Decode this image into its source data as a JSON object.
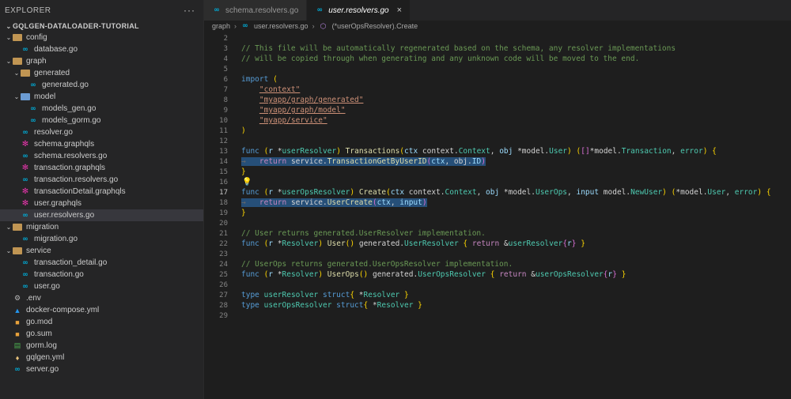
{
  "explorer": {
    "title": "EXPLORER",
    "more": "···",
    "project": "GQLGEN-DATALOADER-TUTORIAL",
    "tree": [
      {
        "label": "config",
        "kind": "folder",
        "indent": 0,
        "open": true
      },
      {
        "label": "database.go",
        "kind": "go",
        "indent": 1
      },
      {
        "label": "graph",
        "kind": "folder",
        "indent": 0,
        "open": true
      },
      {
        "label": "generated",
        "kind": "folder",
        "indent": 1,
        "open": true
      },
      {
        "label": "generated.go",
        "kind": "go",
        "indent": 2
      },
      {
        "label": "model",
        "kind": "folder-blue",
        "indent": 1,
        "open": true
      },
      {
        "label": "models_gen.go",
        "kind": "go",
        "indent": 2
      },
      {
        "label": "models_gorm.go",
        "kind": "go",
        "indent": 2
      },
      {
        "label": "resolver.go",
        "kind": "go",
        "indent": 1
      },
      {
        "label": "schema.graphqls",
        "kind": "gql",
        "indent": 1
      },
      {
        "label": "schema.resolvers.go",
        "kind": "go",
        "indent": 1
      },
      {
        "label": "transaction.graphqls",
        "kind": "gql",
        "indent": 1
      },
      {
        "label": "transaction.resolvers.go",
        "kind": "go",
        "indent": 1
      },
      {
        "label": "transactionDetail.graphqls",
        "kind": "gql",
        "indent": 1
      },
      {
        "label": "user.graphqls",
        "kind": "gql",
        "indent": 1
      },
      {
        "label": "user.resolvers.go",
        "kind": "go",
        "indent": 1,
        "selected": true
      },
      {
        "label": "migration",
        "kind": "folder",
        "indent": 0,
        "open": true
      },
      {
        "label": "migration.go",
        "kind": "go",
        "indent": 1
      },
      {
        "label": "service",
        "kind": "folder",
        "indent": 0,
        "open": true
      },
      {
        "label": "transaction_detail.go",
        "kind": "go",
        "indent": 1
      },
      {
        "label": "transaction.go",
        "kind": "go",
        "indent": 1
      },
      {
        "label": "user.go",
        "kind": "go",
        "indent": 1
      },
      {
        "label": ".env",
        "kind": "gear",
        "indent": 0
      },
      {
        "label": "docker-compose.yml",
        "kind": "docker",
        "indent": 0
      },
      {
        "label": "go.mod",
        "kind": "gomod",
        "indent": 0
      },
      {
        "label": "go.sum",
        "kind": "gomod",
        "indent": 0
      },
      {
        "label": "gorm.log",
        "kind": "log",
        "indent": 0
      },
      {
        "label": "gqlgen.yml",
        "kind": "yml",
        "indent": 0
      },
      {
        "label": "server.go",
        "kind": "go",
        "indent": 0
      }
    ]
  },
  "tabs": [
    {
      "label": "schema.resolvers.go",
      "active": false
    },
    {
      "label": "user.resolvers.go",
      "active": true,
      "close": "×"
    }
  ],
  "breadcrumb": {
    "folder": "graph",
    "file": "user.resolvers.go",
    "symbol": "(*userOpsResolver).Create",
    "sep": "›"
  },
  "editor": {
    "current_line": 17,
    "lines": [
      {
        "n": 2,
        "tokens": []
      },
      {
        "n": 3,
        "tokens": [
          [
            "com",
            "// This file will be automatically regenerated based on the schema, any resolver implementations"
          ]
        ]
      },
      {
        "n": 4,
        "tokens": [
          [
            "com",
            "// will be copied through when generating and any unknown code will be moved to the end."
          ]
        ]
      },
      {
        "n": 5,
        "tokens": []
      },
      {
        "n": 6,
        "tokens": [
          [
            "kw",
            "import"
          ],
          [
            "txt",
            " "
          ],
          [
            "br",
            "("
          ]
        ]
      },
      {
        "n": 7,
        "tokens": [
          [
            "txt",
            "    "
          ],
          [
            "str",
            "\"context\""
          ]
        ]
      },
      {
        "n": 8,
        "tokens": [
          [
            "txt",
            "    "
          ],
          [
            "str",
            "\"myapp/graph/generated\""
          ]
        ]
      },
      {
        "n": 9,
        "tokens": [
          [
            "txt",
            "    "
          ],
          [
            "str",
            "\"myapp/graph/model\""
          ]
        ]
      },
      {
        "n": 10,
        "tokens": [
          [
            "txt",
            "    "
          ],
          [
            "str",
            "\"myapp/service\""
          ]
        ]
      },
      {
        "n": 11,
        "tokens": [
          [
            "br",
            ")"
          ]
        ]
      },
      {
        "n": 12,
        "tokens": []
      },
      {
        "n": 13,
        "tokens": [
          [
            "kw",
            "func"
          ],
          [
            "txt",
            " "
          ],
          [
            "br",
            "("
          ],
          [
            "var",
            "r"
          ],
          [
            "txt",
            " *"
          ],
          [
            "type",
            "userResolver"
          ],
          [
            "br",
            ")"
          ],
          [
            "txt",
            " "
          ],
          [
            "fn",
            "Transactions"
          ],
          [
            "br",
            "("
          ],
          [
            "var",
            "ctx"
          ],
          [
            "txt",
            " context."
          ],
          [
            "type",
            "Context"
          ],
          [
            "txt",
            ", "
          ],
          [
            "var",
            "obj"
          ],
          [
            "txt",
            " *model."
          ],
          [
            "type",
            "User"
          ],
          [
            "br",
            ")"
          ],
          [
            "txt",
            " "
          ],
          [
            "br",
            "("
          ],
          [
            "br2",
            "[]"
          ],
          [
            "txt",
            "*model."
          ],
          [
            "type",
            "Transaction"
          ],
          [
            "txt",
            ", "
          ],
          [
            "type",
            "error"
          ],
          [
            "br",
            ")"
          ],
          [
            "txt",
            " "
          ],
          [
            "br",
            "{"
          ]
        ]
      },
      {
        "n": 14,
        "hl": true,
        "tokens": [
          [
            "tab",
            "→   "
          ],
          [
            "ctl",
            "return"
          ],
          [
            "txt",
            " service."
          ],
          [
            "fn",
            "TransactionGetByUserID"
          ],
          [
            "br2",
            "("
          ],
          [
            "var",
            "ctx"
          ],
          [
            "txt",
            ", obj."
          ],
          [
            "var",
            "ID"
          ],
          [
            "br2",
            ")"
          ]
        ]
      },
      {
        "n": 15,
        "tokens": [
          [
            "br",
            "}"
          ]
        ]
      },
      {
        "n": 16,
        "bulb": true,
        "tokens": []
      },
      {
        "n": 17,
        "tokens": [
          [
            "kw",
            "func"
          ],
          [
            "txt",
            " "
          ],
          [
            "br",
            "("
          ],
          [
            "var",
            "r"
          ],
          [
            "txt",
            " *"
          ],
          [
            "type",
            "userOpsResolver"
          ],
          [
            "br",
            ")"
          ],
          [
            "txt",
            " "
          ],
          [
            "fn",
            "Create"
          ],
          [
            "br",
            "("
          ],
          [
            "var",
            "ctx"
          ],
          [
            "txt",
            " context."
          ],
          [
            "type",
            "Context"
          ],
          [
            "txt",
            ", "
          ],
          [
            "var",
            "obj"
          ],
          [
            "txt",
            " *model."
          ],
          [
            "type",
            "UserOps"
          ],
          [
            "txt",
            ", "
          ],
          [
            "var",
            "input"
          ],
          [
            "txt",
            " model."
          ],
          [
            "type",
            "NewUser"
          ],
          [
            "br",
            ")"
          ],
          [
            "txt",
            " "
          ],
          [
            "br",
            "("
          ],
          [
            "txt",
            "*model."
          ],
          [
            "type",
            "User"
          ],
          [
            "txt",
            ", "
          ],
          [
            "type",
            "error"
          ],
          [
            "br",
            ")"
          ],
          [
            "txt",
            " "
          ],
          [
            "br",
            "{"
          ]
        ]
      },
      {
        "n": 18,
        "hl": true,
        "tokens": [
          [
            "tab",
            "→   "
          ],
          [
            "ctl",
            "return"
          ],
          [
            "txt",
            " service."
          ],
          [
            "fn",
            "UserCreate"
          ],
          [
            "br2",
            "("
          ],
          [
            "var",
            "ctx"
          ],
          [
            "txt",
            ", "
          ],
          [
            "var",
            "input"
          ],
          [
            "br2",
            ")"
          ]
        ]
      },
      {
        "n": 19,
        "tokens": [
          [
            "br",
            "}"
          ]
        ]
      },
      {
        "n": 20,
        "tokens": []
      },
      {
        "n": 21,
        "tokens": [
          [
            "com",
            "// User returns generated.UserResolver implementation."
          ]
        ]
      },
      {
        "n": 22,
        "tokens": [
          [
            "kw",
            "func"
          ],
          [
            "txt",
            " "
          ],
          [
            "br",
            "("
          ],
          [
            "var",
            "r"
          ],
          [
            "txt",
            " *"
          ],
          [
            "type",
            "Resolver"
          ],
          [
            "br",
            ")"
          ],
          [
            "txt",
            " "
          ],
          [
            "fn",
            "User"
          ],
          [
            "br",
            "()"
          ],
          [
            "txt",
            " generated."
          ],
          [
            "type",
            "UserResolver"
          ],
          [
            "txt",
            " "
          ],
          [
            "br",
            "{"
          ],
          [
            "txt",
            " "
          ],
          [
            "ctl",
            "return"
          ],
          [
            "txt",
            " &"
          ],
          [
            "type",
            "userResolver"
          ],
          [
            "br2",
            "{"
          ],
          [
            "var",
            "r"
          ],
          [
            "br2",
            "}"
          ],
          [
            "txt",
            " "
          ],
          [
            "br",
            "}"
          ]
        ]
      },
      {
        "n": 23,
        "tokens": []
      },
      {
        "n": 24,
        "tokens": [
          [
            "com",
            "// UserOps returns generated.UserOpsResolver implementation."
          ]
        ]
      },
      {
        "n": 25,
        "tokens": [
          [
            "kw",
            "func"
          ],
          [
            "txt",
            " "
          ],
          [
            "br",
            "("
          ],
          [
            "var",
            "r"
          ],
          [
            "txt",
            " *"
          ],
          [
            "type",
            "Resolver"
          ],
          [
            "br",
            ")"
          ],
          [
            "txt",
            " "
          ],
          [
            "fn",
            "UserOps"
          ],
          [
            "br",
            "()"
          ],
          [
            "txt",
            " generated."
          ],
          [
            "type",
            "UserOpsResolver"
          ],
          [
            "txt",
            " "
          ],
          [
            "br",
            "{"
          ],
          [
            "txt",
            " "
          ],
          [
            "ctl",
            "return"
          ],
          [
            "txt",
            " &"
          ],
          [
            "type",
            "userOpsResolver"
          ],
          [
            "br2",
            "{"
          ],
          [
            "var",
            "r"
          ],
          [
            "br2",
            "}"
          ],
          [
            "txt",
            " "
          ],
          [
            "br",
            "}"
          ]
        ]
      },
      {
        "n": 26,
        "tokens": []
      },
      {
        "n": 27,
        "tokens": [
          [
            "kw",
            "type"
          ],
          [
            "txt",
            " "
          ],
          [
            "type",
            "userResolver"
          ],
          [
            "txt",
            " "
          ],
          [
            "kw",
            "struct"
          ],
          [
            "br",
            "{"
          ],
          [
            "txt",
            " *"
          ],
          [
            "type",
            "Resolver"
          ],
          [
            "txt",
            " "
          ],
          [
            "br",
            "}"
          ]
        ]
      },
      {
        "n": 28,
        "tokens": [
          [
            "kw",
            "type"
          ],
          [
            "txt",
            " "
          ],
          [
            "type",
            "userOpsResolver"
          ],
          [
            "txt",
            " "
          ],
          [
            "kw",
            "struct"
          ],
          [
            "br",
            "{"
          ],
          [
            "txt",
            " *"
          ],
          [
            "type",
            "Resolver"
          ],
          [
            "txt",
            " "
          ],
          [
            "br",
            "}"
          ]
        ]
      },
      {
        "n": 29,
        "tokens": []
      }
    ]
  },
  "colors": {
    "editor_bg": "#1e1e1e",
    "sidebar_bg": "#252526",
    "selection": "#264f78",
    "go_icon": "#00acd7",
    "graphql_icon": "#e535ab",
    "folder": "#c09553"
  }
}
